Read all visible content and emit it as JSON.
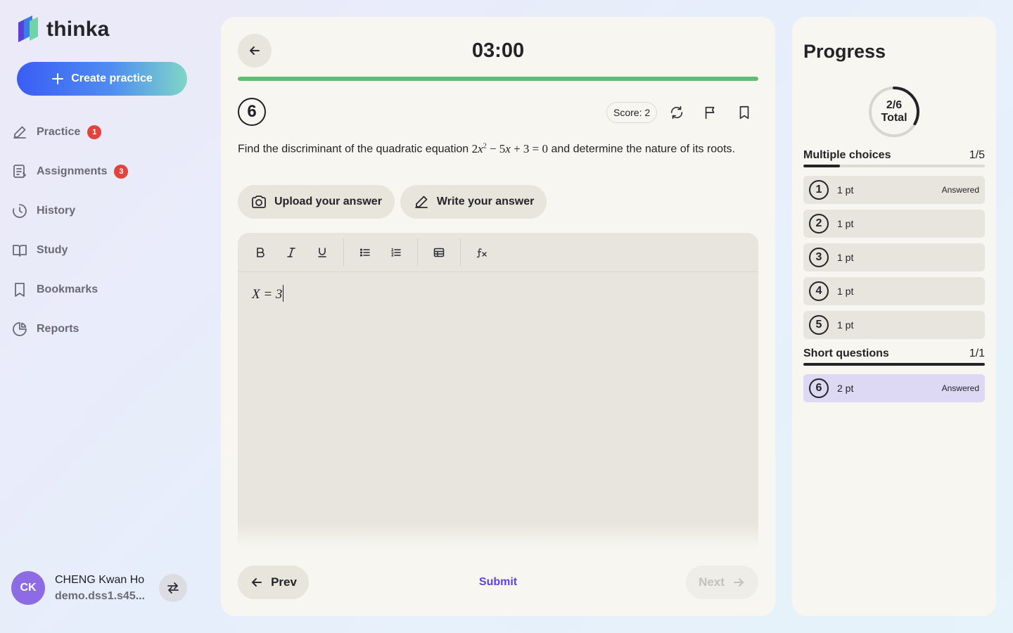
{
  "brand": {
    "name": "thinka"
  },
  "sidebar": {
    "create_label": "Create practice",
    "items": [
      {
        "label": "Practice",
        "icon": "pencil-icon",
        "badge": "1"
      },
      {
        "label": "Assignments",
        "icon": "assignment-icon",
        "badge": "3"
      },
      {
        "label": "History",
        "icon": "history-icon"
      },
      {
        "label": "Study",
        "icon": "book-icon"
      },
      {
        "label": "Bookmarks",
        "icon": "bookmark-icon"
      },
      {
        "label": "Reports",
        "icon": "pie-chart-icon"
      }
    ]
  },
  "user": {
    "initials": "CK",
    "name": "CHENG Kwan Ho",
    "email": "demo.dss1.s45..."
  },
  "quiz": {
    "timer": "03:00",
    "progress_percent": 100,
    "question_number": "6",
    "score_label": "Score: 2",
    "question_before": "Find the discriminant of the quadratic equation",
    "question_after": "and determine the nature of its roots.",
    "answer_tabs": {
      "upload": "Upload your answer",
      "write": "Write your answer"
    },
    "answer_text": "X = 3",
    "prev_label": "Prev",
    "submit_label": "Submit",
    "next_label": "Next"
  },
  "progress": {
    "title": "Progress",
    "total_fraction": "2/6",
    "total_label": "Total",
    "total_ratio": 0.3333,
    "sections": [
      {
        "title": "Multiple choices",
        "count": "1/5",
        "fill": 0.2,
        "questions": [
          {
            "num": "1",
            "pts": "1 pt",
            "status": "Answered"
          },
          {
            "num": "2",
            "pts": "1 pt",
            "status": ""
          },
          {
            "num": "3",
            "pts": "1 pt",
            "status": ""
          },
          {
            "num": "4",
            "pts": "1 pt",
            "status": ""
          },
          {
            "num": "5",
            "pts": "1 pt",
            "status": ""
          }
        ]
      },
      {
        "title": "Short questions",
        "count": "1/1",
        "fill": 1.0,
        "questions": [
          {
            "num": "6",
            "pts": "2 pt",
            "status": "Answered"
          }
        ]
      }
    ]
  },
  "colors": {
    "accent": "#5b45e0",
    "progress_green": "#5fbf6e",
    "badge_red": "#e2433c",
    "avatar": "#8d6be4"
  }
}
